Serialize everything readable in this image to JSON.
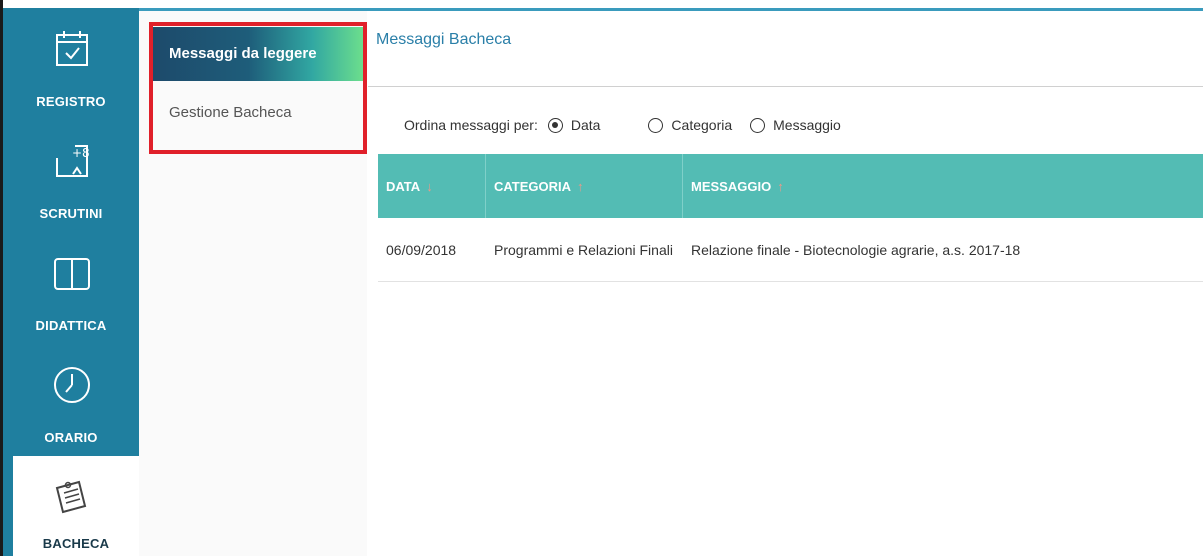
{
  "leftnav": {
    "items": [
      {
        "label": "REGISTRO",
        "icon": "calendar-check-icon"
      },
      {
        "label": "SCRUTINI",
        "icon": "grades-plus-icon"
      },
      {
        "label": "DIDATTICA",
        "icon": "book-icon"
      },
      {
        "label": "ORARIO",
        "icon": "clock-icon"
      },
      {
        "label": "BACHECA",
        "icon": "notice-board-icon"
      }
    ],
    "active": "BACHECA"
  },
  "submenu": {
    "items": [
      {
        "label": "Messaggi da leggere"
      },
      {
        "label": "Gestione Bacheca"
      }
    ]
  },
  "main": {
    "title": "Messaggi Bacheca",
    "sort": {
      "label": "Ordina messaggi per:",
      "options": [
        "Data",
        "Categoria",
        "Messaggio"
      ],
      "selected": "Data"
    },
    "table": {
      "headers": [
        "DATA",
        "CATEGORIA",
        "MESSAGGIO"
      ],
      "rows": [
        {
          "data": "06/09/2018",
          "categoria": "Programmi e Relazioni Finali",
          "messaggio": "Relazione finale - Biotecnologie agrarie, a.s. 2017-18"
        }
      ]
    }
  },
  "colors": {
    "nav": "#1f7f9f",
    "table_header": "#53bcb4",
    "highlight_border": "#e0202a",
    "title": "#2a7fa8"
  }
}
